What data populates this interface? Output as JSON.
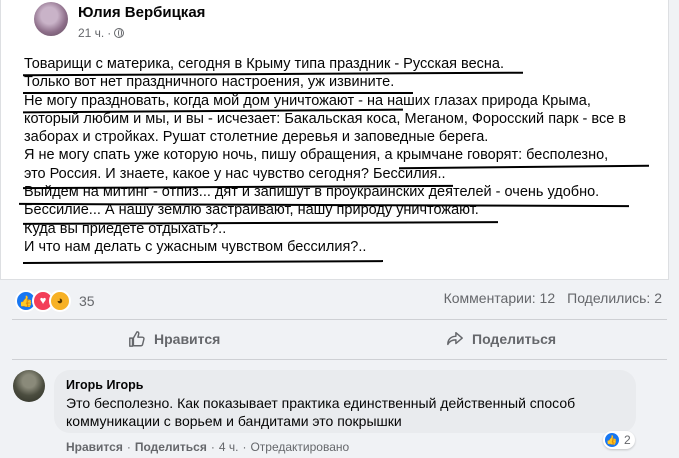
{
  "post": {
    "author": "Юлия Вербицкая",
    "time": "21 ч.",
    "lines": [
      "Товарищи с материка, сегодня в Крыму типа праздник - Русская весна.",
      "Только вот нет праздничного настроения, уж извините.",
      "Не могу праздновать, когда мой дом уничтожают - на наших глазах природа Крыма,",
      "который любим и мы, и вы - исчезает: Бакальская коса, Меганом, Форосский парк - все в",
      "заборах и стройках. Рушат столетние деревья и заповедные берега.",
      "Я не могу спать уже которую ночь, пишу обращения, а крымчане говорят: бесполезно,",
      "это Россия. И знаете, какое у нас чувство сегодня? Бессилия..",
      "Выйдем на митинг - отпиз... дят и запишут в проукраинских деятелей - очень удобно.",
      "Бессилие... А нашу землю застраивают, нашу природу уничтожают.",
      "Куда вы приедете отдыхать?..",
      "И что нам делать с ужасным чувством бессилия?.."
    ]
  },
  "stats": {
    "reactions_count": "35",
    "comments": "Комментарии: 12",
    "shares": "Поделились: 2"
  },
  "actions": {
    "like": "Нравится",
    "share": "Поделиться"
  },
  "comment": {
    "author": "Игорь Игорь",
    "text": "Это бесполезно. Как показывает практика единственный действенный способ коммуникации с ворьем и бандитами это покрышки",
    "reactions_count": "2",
    "like": "Нравится",
    "reply": "Поделиться",
    "time": "4 ч.",
    "edited": "Отредактировано"
  }
}
